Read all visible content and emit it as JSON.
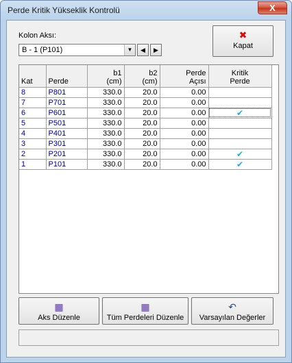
{
  "window": {
    "title": "Perde Kritik Yükseklik Kontrolü",
    "close_glyph": "X"
  },
  "kolon": {
    "label": "Kolon Aksı:",
    "selected": "B - 1 (P101)"
  },
  "close_button": {
    "label": "Kapat",
    "icon": "close-x-icon",
    "icon_color": "#cc1111",
    "glyph": "✖"
  },
  "table": {
    "headers": {
      "kat": "Kat",
      "perde": "Perde",
      "b1_line1": "b1",
      "b1_line2": "(cm)",
      "b2_line1": "b2",
      "b2_line2": "(cm)",
      "aci_line1": "Perde",
      "aci_line2": "Açısı",
      "kritik_line1": "Kritik",
      "kritik_line2": "Perde"
    },
    "rows": [
      {
        "kat": "8",
        "perde": "P801",
        "b1": "330.0",
        "b2": "20.0",
        "aci": "0.00",
        "kritik": ""
      },
      {
        "kat": "7",
        "perde": "P701",
        "b1": "330.0",
        "b2": "20.0",
        "aci": "0.00",
        "kritik": ""
      },
      {
        "kat": "6",
        "perde": "P601",
        "b1": "330.0",
        "b2": "20.0",
        "aci": "0.00",
        "kritik": "✔"
      },
      {
        "kat": "5",
        "perde": "P501",
        "b1": "330.0",
        "b2": "20.0",
        "aci": "0.00",
        "kritik": ""
      },
      {
        "kat": "4",
        "perde": "P401",
        "b1": "330.0",
        "b2": "20.0",
        "aci": "0.00",
        "kritik": ""
      },
      {
        "kat": "3",
        "perde": "P301",
        "b1": "330.0",
        "b2": "20.0",
        "aci": "0.00",
        "kritik": ""
      },
      {
        "kat": "2",
        "perde": "P201",
        "b1": "330.0",
        "b2": "20.0",
        "aci": "0.00",
        "kritik": "✔"
      },
      {
        "kat": "1",
        "perde": "P101",
        "b1": "330.0",
        "b2": "20.0",
        "aci": "0.00",
        "kritik": "✔"
      }
    ]
  },
  "buttons": {
    "aks_duzenle": {
      "label": "Aks Düzenle",
      "icon": "edit-table-icon",
      "glyph": "▦"
    },
    "tum_perdeler": {
      "label": "Tüm Perdeleri Düzenle",
      "icon": "edit-table-icon",
      "glyph": "▦"
    },
    "varsayilan": {
      "label": "Varsayılan Değerler",
      "icon": "undo-icon",
      "glyph": "↶"
    }
  },
  "colors": {
    "accent_text": "#000080",
    "check": "#2aa7c9"
  }
}
